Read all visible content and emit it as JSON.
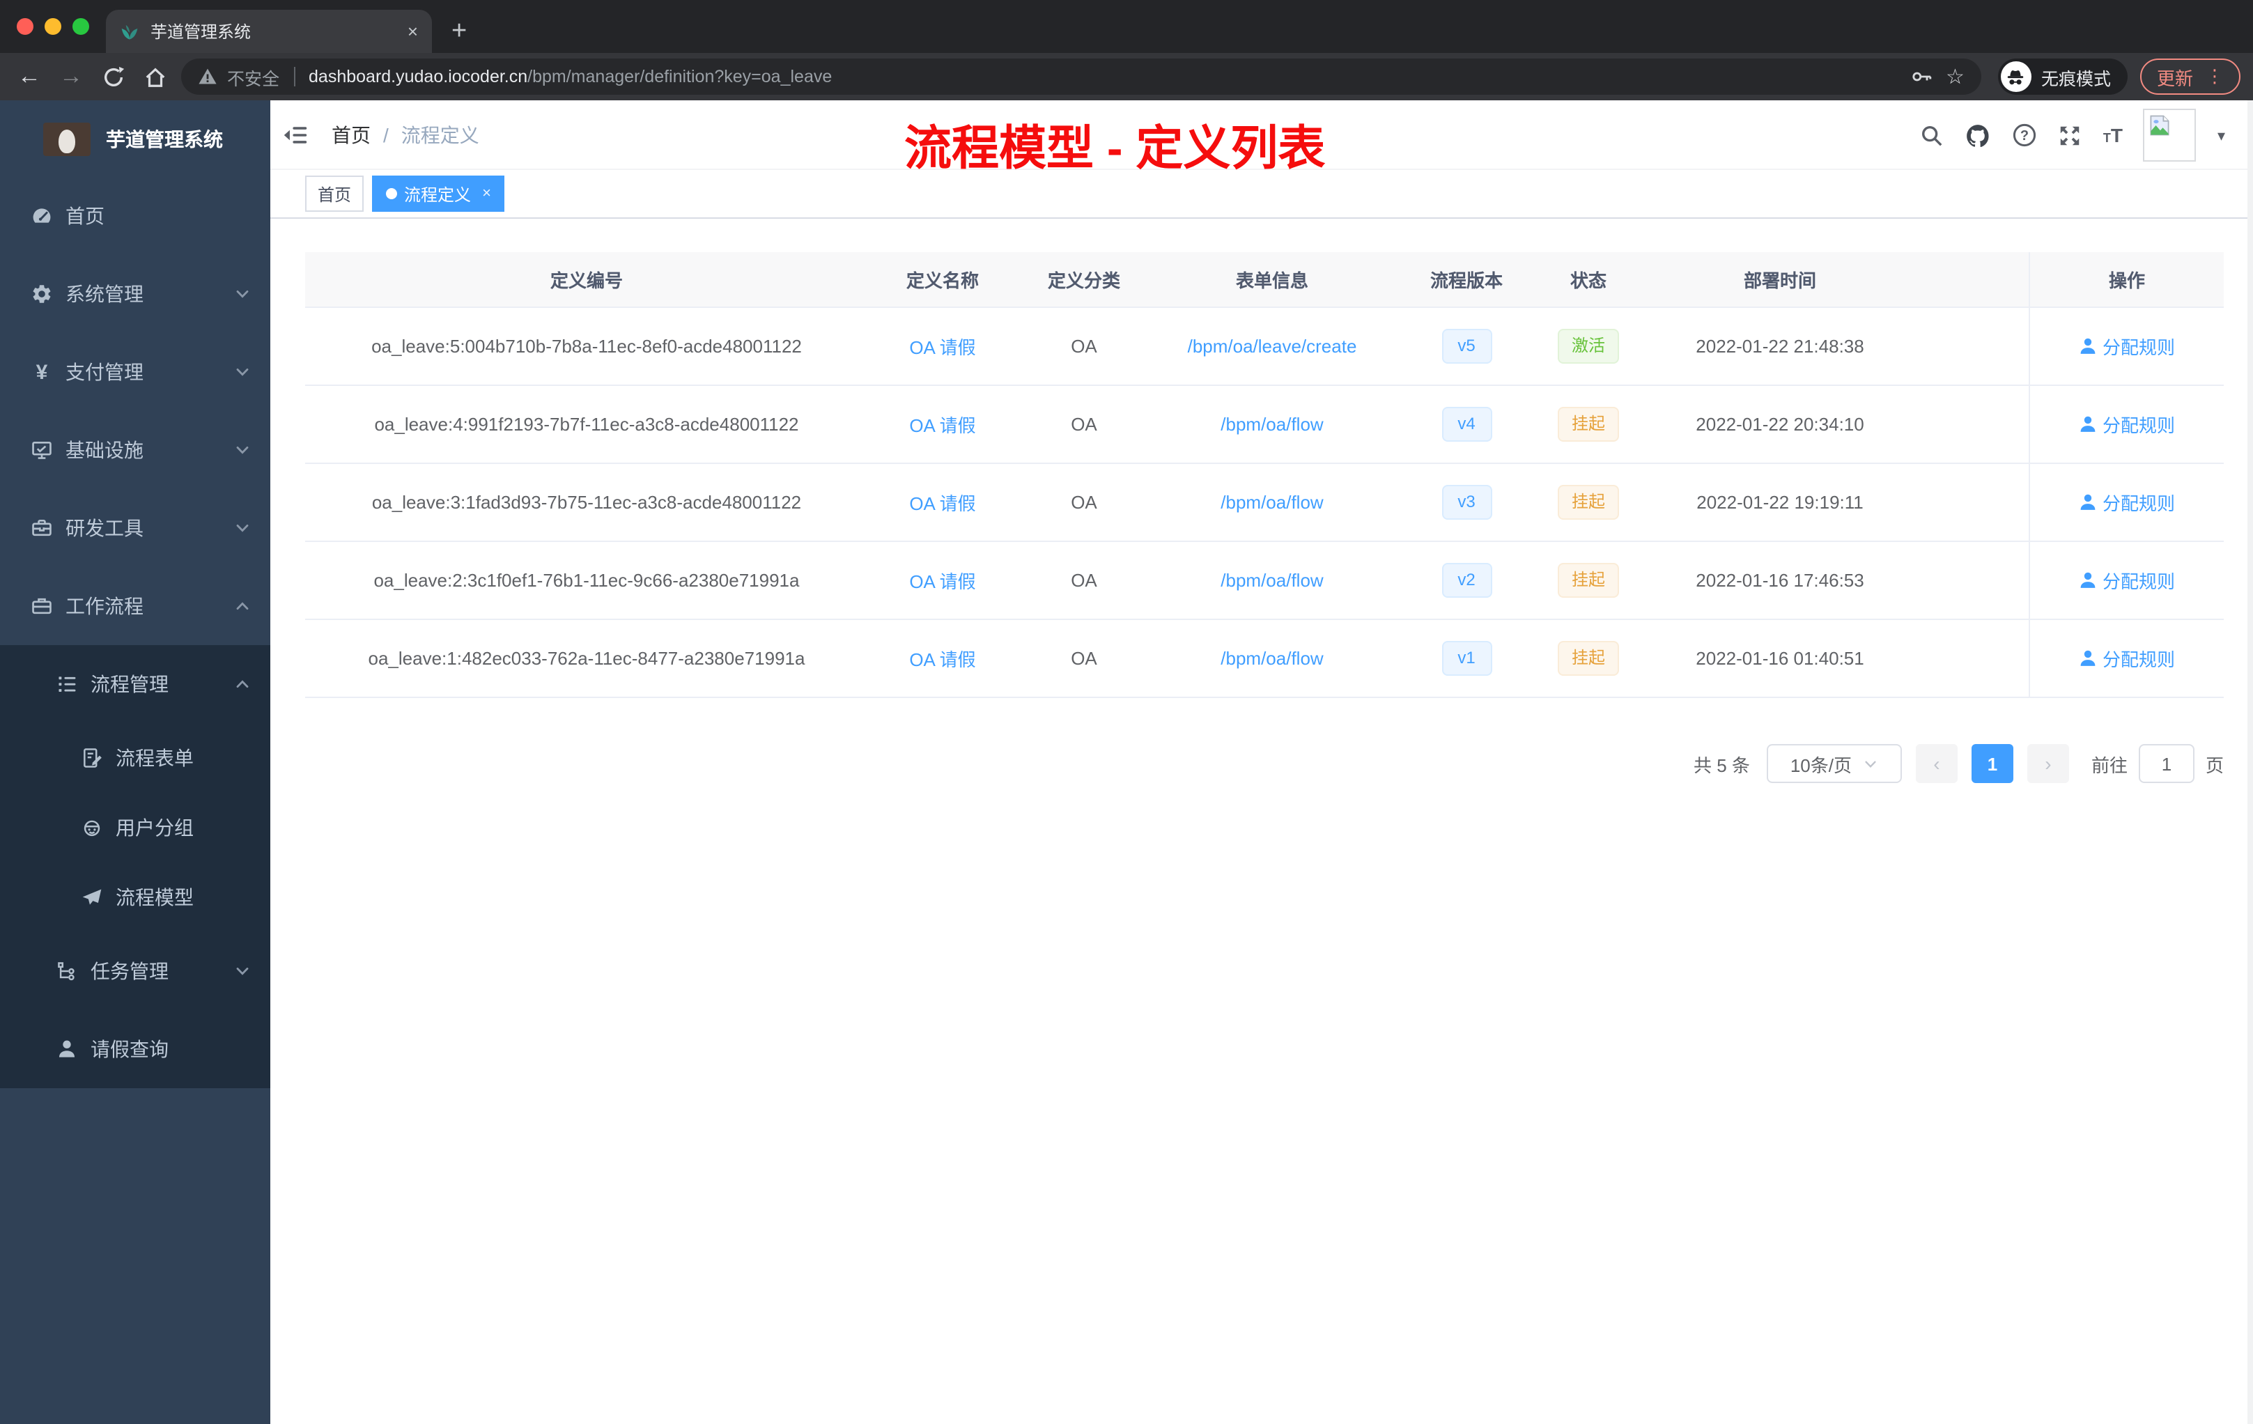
{
  "colors": {
    "accent": "#409eff",
    "success": "#67c23a",
    "warning": "#e6a23c",
    "annotation_red": "#f50d0d",
    "sidebar_bg": "#304156",
    "submenu_bg": "#1f2d3d"
  },
  "browser": {
    "tab_title": "芋道管理系统",
    "tab_close_glyph": "×",
    "new_tab_glyph": "+",
    "back_glyph": "←",
    "forward_glyph": "→",
    "security_label": "不安全",
    "url_domain": "dashboard.yudao.iocoder.cn",
    "url_path": "/bpm/manager/definition?key=oa_leave",
    "bookmark_glyph": "☆",
    "incognito_label": "无痕模式",
    "update_label": "更新",
    "menu_glyph": "⋮"
  },
  "sidebar": {
    "app_title": "芋道管理系统",
    "menu": [
      {
        "label": "首页"
      },
      {
        "label": "系统管理"
      },
      {
        "label": "支付管理",
        "icon_glyph": "¥"
      },
      {
        "label": "基础设施"
      },
      {
        "label": "研发工具"
      },
      {
        "label": "工作流程"
      },
      {
        "label": "流程管理"
      },
      {
        "label": "流程表单"
      },
      {
        "label": "用户分组"
      },
      {
        "label": "流程模型"
      },
      {
        "label": "任务管理"
      },
      {
        "label": "请假查询"
      }
    ]
  },
  "navbar": {
    "breadcrumb_home": "首页",
    "breadcrumb_separator": "/",
    "breadcrumb_current": "流程定义",
    "question_glyph": "?",
    "font_small_glyph": "T",
    "font_large_glyph": "T",
    "caret_glyph": "▾"
  },
  "annotation": {
    "text": "流程模型 - 定义列表"
  },
  "tags": {
    "home": "首页",
    "active": "流程定义",
    "close_glyph": "×"
  },
  "table": {
    "headers": {
      "id": "定义编号",
      "name": "定义名称",
      "category": "定义分类",
      "form": "表单信息",
      "version": "流程版本",
      "status": "状态",
      "deploy_time": "部署时间",
      "actions": "操作"
    },
    "rows": [
      {
        "id": "oa_leave:5:004b710b-7b8a-11ec-8ef0-acde48001122",
        "name": "OA 请假",
        "category": "OA",
        "form": "/bpm/oa/leave/create",
        "version": "v5",
        "status": "激活",
        "deploy_time": "2022-01-22 21:48:38",
        "action": "分配规则"
      },
      {
        "id": "oa_leave:4:991f2193-7b7f-11ec-a3c8-acde48001122",
        "name": "OA 请假",
        "category": "OA",
        "form": "/bpm/oa/flow",
        "version": "v4",
        "status": "挂起",
        "deploy_time": "2022-01-22 20:34:10",
        "action": "分配规则"
      },
      {
        "id": "oa_leave:3:1fad3d93-7b75-11ec-a3c8-acde48001122",
        "name": "OA 请假",
        "category": "OA",
        "form": "/bpm/oa/flow",
        "version": "v3",
        "status": "挂起",
        "deploy_time": "2022-01-22 19:19:11",
        "action": "分配规则"
      },
      {
        "id": "oa_leave:2:3c1f0ef1-76b1-11ec-9c66-a2380e71991a",
        "name": "OA 请假",
        "category": "OA",
        "form": "/bpm/oa/flow",
        "version": "v2",
        "status": "挂起",
        "deploy_time": "2022-01-16 17:46:53",
        "action": "分配规则"
      },
      {
        "id": "oa_leave:1:482ec033-762a-11ec-8477-a2380e71991a",
        "name": "OA 请假",
        "category": "OA",
        "form": "/bpm/oa/flow",
        "version": "v1",
        "status": "挂起",
        "deploy_time": "2022-01-16 01:40:51",
        "action": "分配规则"
      }
    ]
  },
  "pagination": {
    "total": "共 5 条",
    "page_size": "10条/页",
    "prev_glyph": "‹",
    "current_page": "1",
    "next_glyph": "›",
    "goto_label": "前往",
    "goto_value": "1",
    "unit_label": "页"
  }
}
